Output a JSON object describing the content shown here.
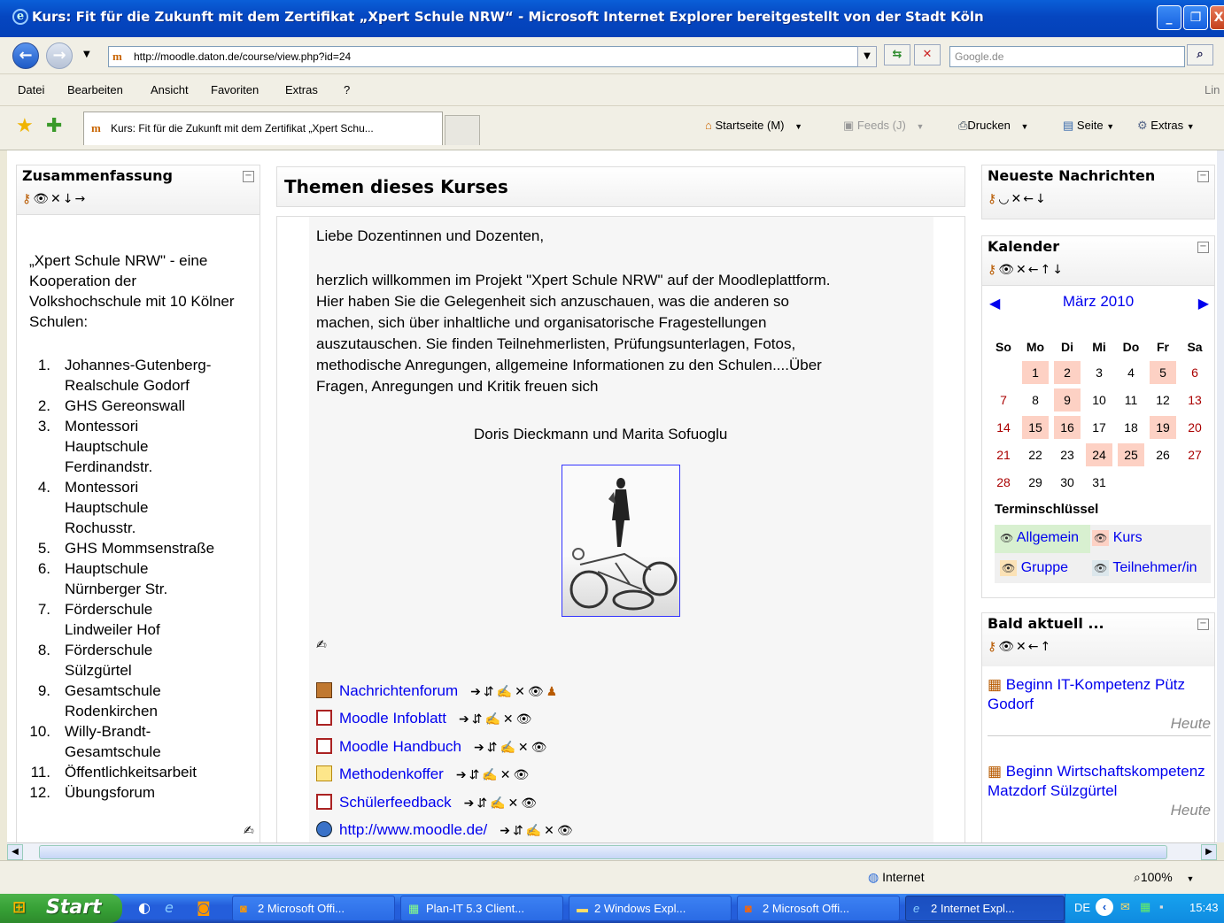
{
  "window": {
    "title": "Kurs: Fit für die Zukunft mit dem Zertifikat „Xpert Schule NRW“ - Microsoft Internet Explorer bereitgestellt von der Stadt Köln"
  },
  "address": {
    "url": "http://moodle.daton.de/course/view.php?id=24",
    "search_placeholder": "Google.de"
  },
  "menu": {
    "items": [
      "Datei",
      "Bearbeiten",
      "Ansicht",
      "Favoriten",
      "Extras",
      "?"
    ],
    "links_label": "Lin"
  },
  "toolbar": {
    "tab_title": "Kurs: Fit für die Zukunft mit dem Zertifikat „Xpert Schu...",
    "home": "Startseite (M)",
    "feeds": "Feeds (J)",
    "print": "Drucken",
    "page": "Seite",
    "extras": "Extras"
  },
  "left": {
    "title": "Zusammenfassung",
    "intro": "„Xpert Schule NRW\" - eine Kooperation der Volkshochschule mit 10 Kölner Schulen:",
    "schools": [
      {
        "n": "1.",
        "lines": [
          "Johannes-Gutenberg-",
          "Realschule Godorf"
        ]
      },
      {
        "n": "2.",
        "lines": [
          "GHS Gereonswall"
        ]
      },
      {
        "n": "3.",
        "lines": [
          "Montessori",
          "Hauptschule",
          "Ferdinandstr."
        ]
      },
      {
        "n": "4.",
        "lines": [
          "Montessori",
          "Hauptschule",
          "Rochusstr."
        ]
      },
      {
        "n": "5.",
        "lines": [
          "GHS Mommsenstraße"
        ]
      },
      {
        "n": "6.",
        "lines": [
          "Hauptschule",
          "Nürnberger Str."
        ]
      },
      {
        "n": "7.",
        "lines": [
          "Förderschule",
          "Lindweiler Hof"
        ]
      },
      {
        "n": "8.",
        "lines": [
          "Förderschule",
          "Sülzgürtel"
        ]
      },
      {
        "n": "9.",
        "lines": [
          "Gesamtschule",
          "Rodenkirchen"
        ]
      },
      {
        "n": "10.",
        "lines": [
          "Willy-Brandt-",
          "Gesamtschule"
        ]
      },
      {
        "n": "11.",
        "lines": [
          "Öffentlichkeitsarbeit"
        ]
      },
      {
        "n": "12.",
        "lines": [
          "Übungsforum"
        ]
      }
    ]
  },
  "main": {
    "heading": "Themen dieses Kurses",
    "greeting": "Liebe Dozentinnen und Dozenten,",
    "para": [
      "herzlich willkommen im Projekt \"Xpert Schule NRW\" auf der Moodleplattform.",
      "Hier haben Sie die Gelegenheit sich anzuschauen, was die anderen so",
      "machen, sich über inhaltliche und organisatorische Fragestellungen",
      "auszutauschen. Sie finden Teilnehmerlisten, Prüfungsunterlagen, Fotos,",
      "methodische Anregungen, allgemeine Informationen zu den Schulen....Über",
      "Fragen, Anregungen und Kritik freuen sich"
    ],
    "signature": "Doris Dieckmann und Marita Sofuoglu",
    "resources": [
      {
        "label": "Nachrichtenforum",
        "icon": "forum-icon"
      },
      {
        "label": "Moodle Infoblatt",
        "icon": "pdf-icon"
      },
      {
        "label": "Moodle Handbuch",
        "icon": "pdf-icon"
      },
      {
        "label": "Methodenkoffer",
        "icon": "folder-icon"
      },
      {
        "label": "Schülerfeedback",
        "icon": "pdf-icon"
      },
      {
        "label": "http://www.moodle.de/",
        "icon": "web-icon"
      }
    ]
  },
  "right": {
    "news_title": "Neueste Nachrichten",
    "cal_title": "Kalender",
    "month": "März 2010",
    "weekdays": [
      "So",
      "Mo",
      "Di",
      "Mi",
      "Do",
      "Fr",
      "Sa"
    ],
    "weeks": [
      [
        "",
        "1",
        "2",
        "3",
        "4",
        "5",
        "6"
      ],
      [
        "7",
        "8",
        "9",
        "10",
        "11",
        "12",
        "13"
      ],
      [
        "14",
        "15",
        "16",
        "17",
        "18",
        "19",
        "20"
      ],
      [
        "21",
        "22",
        "23",
        "24",
        "25",
        "26",
        "27"
      ],
      [
        "28",
        "29",
        "30",
        "31",
        "",
        "",
        ""
      ]
    ],
    "event_days": [
      "1",
      "2",
      "5",
      "9",
      "15",
      "16",
      "19",
      "24",
      "25"
    ],
    "legend_title": "Terminschlüssel",
    "legend": [
      "Allgemein",
      "Kurs",
      "Gruppe",
      "Teilnehmer/in"
    ],
    "upcoming_title": "Bald aktuell ...",
    "events": [
      {
        "title": "Beginn IT-Kompetenz Pütz Godorf",
        "when": "Heute"
      },
      {
        "title": "Beginn Wirtschaftskompetenz Matzdorf Sülzgürtel",
        "when": "Heute"
      }
    ]
  },
  "status": {
    "zone": "Internet",
    "zoom": "100%"
  },
  "taskbar": {
    "start": "Start",
    "buttons": [
      "2 Microsoft Offi...",
      "Plan-IT 5.3 Client...",
      "2 Windows Expl...",
      "2 Microsoft Offi...",
      "2 Internet Expl..."
    ],
    "lang": "DE",
    "clock": "15:43"
  }
}
